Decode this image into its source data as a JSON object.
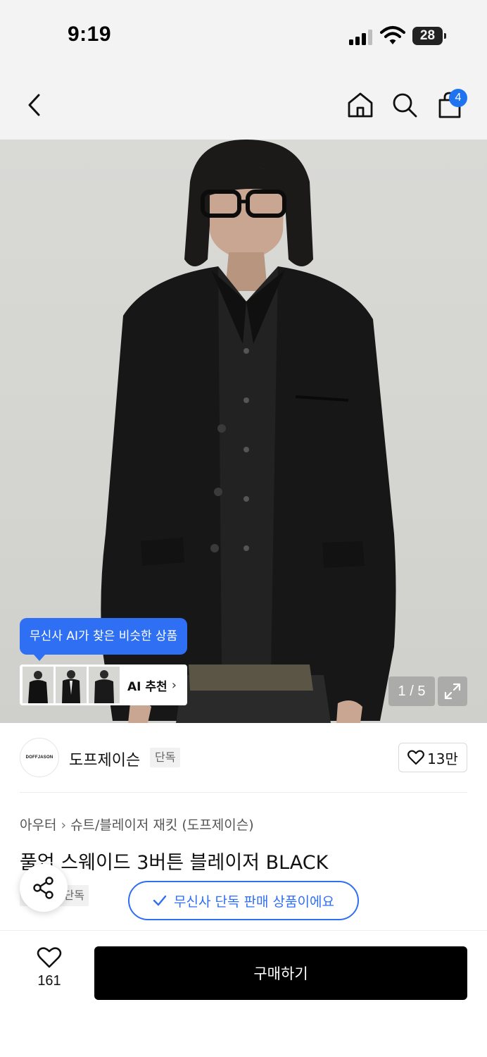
{
  "status_bar": {
    "time": "9:19",
    "battery": "28",
    "icons": [
      "signal-icon",
      "wifi-icon",
      "battery-icon"
    ]
  },
  "top_nav": {
    "icons": [
      "back-chevron-icon",
      "home-icon",
      "search-icon",
      "shopping-bag-icon"
    ],
    "cart_count": "4",
    "accent_color": "#1f73f0"
  },
  "hero": {
    "page_indicator": "1 / 5",
    "expand_icon": "expand-icon",
    "ai_tooltip": "무신사 AI가 찾은 비슷한 상품",
    "ai_recommend_label": "AI 추천",
    "ai_thumbnails": 3
  },
  "brand": {
    "logo_text": "DOFFJASON",
    "name": "도프제이슨",
    "badge": "단독",
    "like_count": "13만"
  },
  "product": {
    "breadcrumb": [
      "아우터",
      "슈트/블레이저 재킷 (도프제이슨)"
    ],
    "title": "풀업 스웨이드 3버튼 블레이저 BLACK",
    "exclusive_tag": "단독",
    "exclusive_notice": "무신사 단독 판매 상품이에요"
  },
  "bottom_bar": {
    "wish_count": "161",
    "buy_label": "구매하기"
  },
  "colors": {
    "brand_blue": "#2e6ff3",
    "buy_button": "#000000"
  }
}
